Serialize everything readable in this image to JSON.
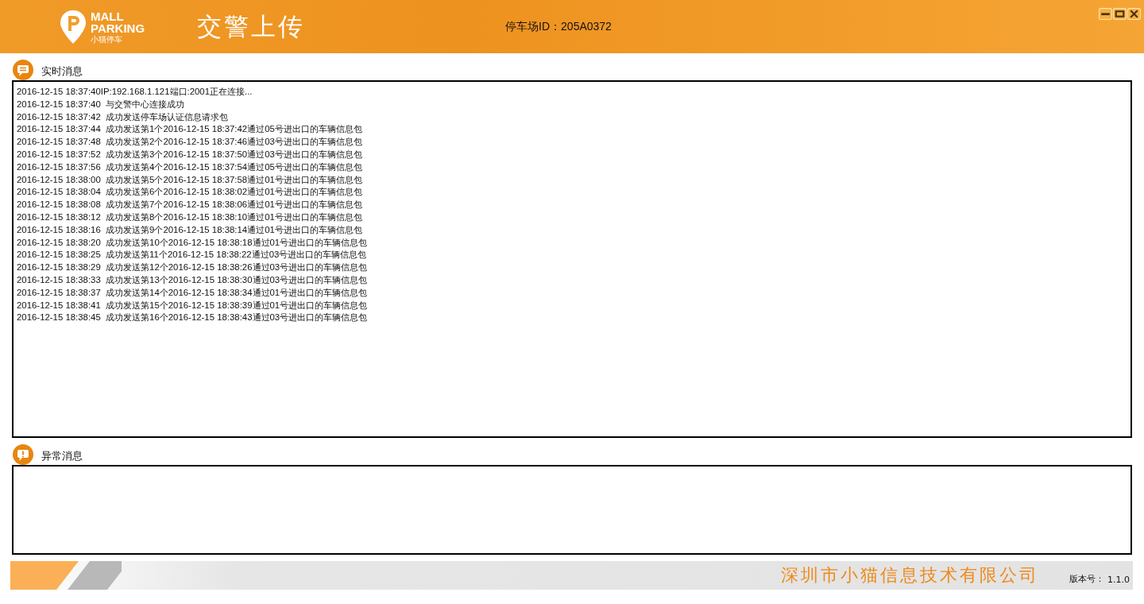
{
  "header": {
    "logo_line_1": "MALL",
    "logo_line_2": "PARKING",
    "logo_subtitle": "小猫停车",
    "title": "交警上传",
    "parking_id": "停车场ID：205A0372"
  },
  "realtime": {
    "label": "实时消息",
    "lines": [
      "2016-12-15 18:37:40IP:192.168.1.121端口:2001正在连接...",
      "2016-12-15 18:37:40  与交警中心连接成功",
      "2016-12-15 18:37:42  成功发送停车场认证信息请求包",
      "2016-12-15 18:37:44  成功发送第1个2016-12-15 18:37:42通过05号进出口的车辆信息包",
      "2016-12-15 18:37:48  成功发送第2个2016-12-15 18:37:46通过03号进出口的车辆信息包",
      "2016-12-15 18:37:52  成功发送第3个2016-12-15 18:37:50通过03号进出口的车辆信息包",
      "2016-12-15 18:37:56  成功发送第4个2016-12-15 18:37:54通过05号进出口的车辆信息包",
      "2016-12-15 18:38:00  成功发送第5个2016-12-15 18:37:58通过01号进出口的车辆信息包",
      "2016-12-15 18:38:04  成功发送第6个2016-12-15 18:38:02通过01号进出口的车辆信息包",
      "2016-12-15 18:38:08  成功发送第7个2016-12-15 18:38:06通过01号进出口的车辆信息包",
      "2016-12-15 18:38:12  成功发送第8个2016-12-15 18:38:10通过01号进出口的车辆信息包",
      "2016-12-15 18:38:16  成功发送第9个2016-12-15 18:38:14通过01号进出口的车辆信息包",
      "2016-12-15 18:38:20  成功发送第10个2016-12-15 18:38:18通过01号进出口的车辆信息包",
      "2016-12-15 18:38:25  成功发送第11个2016-12-15 18:38:22通过03号进出口的车辆信息包",
      "2016-12-15 18:38:29  成功发送第12个2016-12-15 18:38:26通过03号进出口的车辆信息包",
      "2016-12-15 18:38:33  成功发送第13个2016-12-15 18:38:30通过03号进出口的车辆信息包",
      "2016-12-15 18:38:37  成功发送第14个2016-12-15 18:38:34通过01号进出口的车辆信息包",
      "2016-12-15 18:38:41  成功发送第15个2016-12-15 18:38:39通过01号进出口的车辆信息包",
      "2016-12-15 18:38:45  成功发送第16个2016-12-15 18:38:43通过03号进出口的车辆信息包"
    ]
  },
  "errors": {
    "label": "异常消息"
  },
  "footer": {
    "company": "深圳市小猫信息技术有限公司",
    "version_label": "版本号：",
    "version": "1.1.0"
  }
}
